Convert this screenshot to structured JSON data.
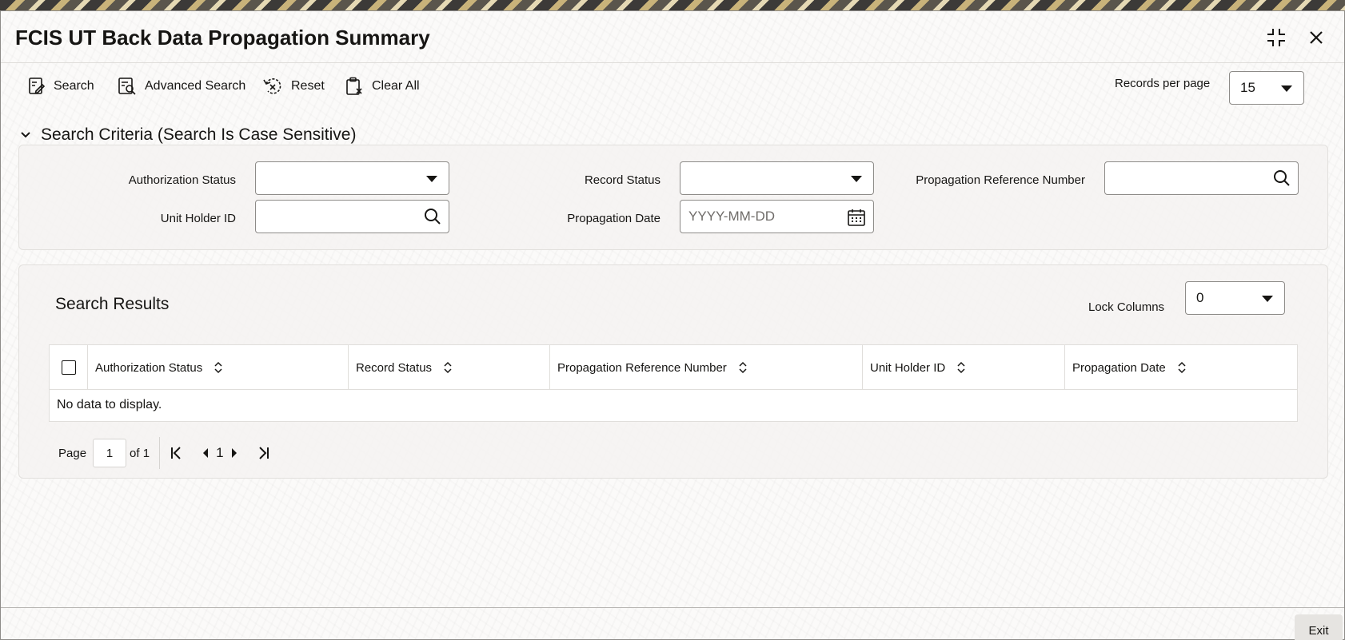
{
  "window": {
    "title": "FCIS UT Back Data Propagation Summary",
    "maximize_icon": "collapse-corners-icon",
    "close_icon": "close-icon"
  },
  "toolbar": {
    "search_label": "Search",
    "advanced_search_label": "Advanced Search",
    "reset_label": "Reset",
    "clear_all_label": "Clear All",
    "records_per_page_label": "Records per page",
    "records_per_page_value": "15"
  },
  "search_criteria": {
    "header": "Search Criteria (Search Is Case Sensitive)",
    "fields": {
      "authorization_status": {
        "label": "Authorization Status",
        "value": ""
      },
      "record_status": {
        "label": "Record Status",
        "value": ""
      },
      "propagation_reference_number": {
        "label": "Propagation Reference Number",
        "value": ""
      },
      "unit_holder_id": {
        "label": "Unit Holder ID",
        "value": ""
      },
      "propagation_date": {
        "label": "Propagation Date",
        "placeholder": "YYYY-MM-DD",
        "value": ""
      }
    }
  },
  "search_results": {
    "title": "Search Results",
    "lock_columns_label": "Lock Columns",
    "lock_columns_value": "0",
    "columns": [
      "Authorization Status",
      "Record Status",
      "Propagation Reference Number",
      "Unit Holder ID",
      "Propagation Date"
    ],
    "empty_message": "No data to display."
  },
  "pagination": {
    "page_label": "Page",
    "current_page": "1",
    "of_label": "of 1",
    "page_number": "1"
  },
  "footer": {
    "exit_label": "Exit"
  },
  "colors": {
    "text": "#161513",
    "border": "#8d8b88",
    "panel": "#f5f3f1"
  }
}
